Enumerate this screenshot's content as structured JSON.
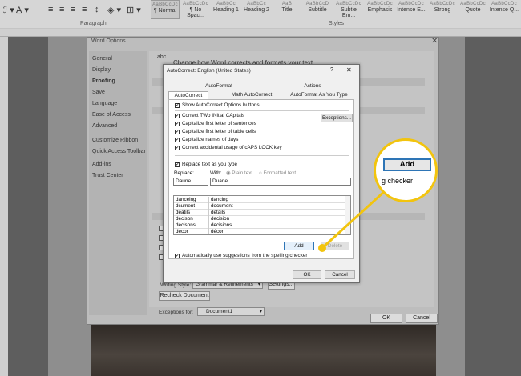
{
  "ribbon": {
    "styles": [
      {
        "sample": "AaBbCcDc",
        "label": "¶ Normal"
      },
      {
        "sample": "AaBbCcDc",
        "label": "¶ No Spac..."
      },
      {
        "sample": "AaBbCc",
        "label": "Heading 1"
      },
      {
        "sample": "AaBbCc",
        "label": "Heading 2"
      },
      {
        "sample": "AaB",
        "label": "Title"
      },
      {
        "sample": "AaBbCcD",
        "label": "Subtitle"
      },
      {
        "sample": "AaBbCcDc",
        "label": "Subtle Em..."
      },
      {
        "sample": "AaBbCcDc",
        "label": "Emphasis"
      },
      {
        "sample": "AaBbCcDc",
        "label": "Intense E..."
      },
      {
        "sample": "AaBbCcDc",
        "label": "Strong"
      },
      {
        "sample": "AaBbCcDc",
        "label": "Quote"
      },
      {
        "sample": "AaBbCcDc",
        "label": "Intense Q..."
      }
    ],
    "groups": {
      "paragraph": "Paragraph",
      "styles": "Styles"
    }
  },
  "word_options": {
    "title": "Word Options",
    "close": "✕",
    "sidebar": [
      "General",
      "Display",
      "Proofing",
      "Save",
      "Language",
      "Ease of Access",
      "Advanced",
      "Customize Ribbon",
      "Quick Access Toolbar",
      "Add-ins",
      "Trust Center"
    ],
    "header": "Change how Word corrects and formats your text.",
    "abc": "abc",
    "writing_style_label": "Writing Style:",
    "writing_style_value": "Grammar & Refinements",
    "settings_button": "Settings...",
    "recheck_button": "Recheck Document",
    "exceptions_label": "Exceptions for:",
    "exceptions_value": "Document1",
    "ok": "OK",
    "cancel": "Cancel"
  },
  "autocorrect": {
    "title": "AutoCorrect: English (United States)",
    "help": "?",
    "close": "✕",
    "tabs_top": [
      "AutoFormat",
      "Actions"
    ],
    "tabs_bottom": [
      "AutoCorrect",
      "Math AutoCorrect",
      "AutoFormat As You Type"
    ],
    "show_options": "Show AutoCorrect Options buttons",
    "options": [
      "Correct TWo INitial CApitals",
      "Capitalize first letter of sentences",
      "Capitalize first letter of table cells",
      "Capitalize names of days",
      "Correct accidental usage of cAPS LOCK key"
    ],
    "exceptions_button": "Exceptions...",
    "replace_as_type": "Replace text as you type",
    "replace_label": "Replace:",
    "with_label": "With:",
    "plain_text": "Plain text",
    "formatted_text": "Formatted text",
    "replace_value": "Daune",
    "with_value": "Duane",
    "list": [
      [
        "danceing",
        "dancing"
      ],
      [
        "dcument",
        "document"
      ],
      [
        "deatils",
        "details"
      ],
      [
        "decison",
        "decision"
      ],
      [
        "decisons",
        "decisions"
      ],
      [
        "decor",
        "décor"
      ]
    ],
    "add_button": "Add",
    "delete_button": "Delete",
    "auto_suggest": "Automatically use suggestions from the spelling checker",
    "ok": "OK",
    "cancel": "Cancel"
  },
  "callout": {
    "button": "Add",
    "text": "g checker",
    "color": "#f2c40e"
  }
}
